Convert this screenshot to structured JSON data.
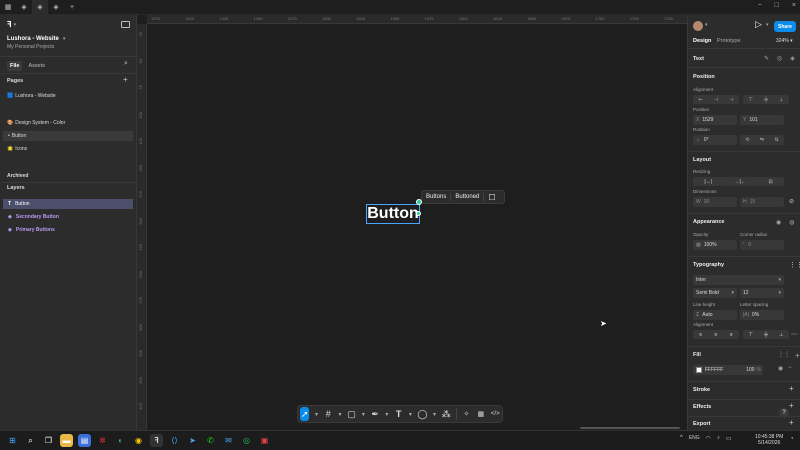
{
  "titlebar": {
    "tabs": [
      "▦",
      "◈",
      "◈",
      "◈",
      "+"
    ],
    "controls": [
      "−",
      "□",
      "×"
    ]
  },
  "left": {
    "project_name": "Lushora - Website",
    "project_sub": "My Personal Projects",
    "tabs": [
      "File",
      "Assets"
    ],
    "pages_label": "Pages",
    "pages_top": [
      "Lushora - Website"
    ],
    "pages": [
      "Design System - Color",
      "Button",
      "Icons"
    ],
    "archived_label": "Archived",
    "layers_label": "Layers",
    "layers": [
      {
        "icon": "T",
        "label": "Button"
      },
      {
        "icon": "◈",
        "label": "Secondary Button"
      },
      {
        "icon": "◈",
        "label": "Primary Buttons"
      }
    ]
  },
  "canvas": {
    "ruler_top": [
      "1375",
      "1400",
      "1425",
      "1450",
      "1475",
      "1500",
      "1525",
      "1550",
      "1575",
      "1600",
      "1625",
      "1650",
      "1675",
      "1700",
      "1725",
      "1750"
    ],
    "ruler_left": [
      "25",
      "50",
      "75",
      "100",
      "125",
      "150",
      "175",
      "200",
      "225",
      "250",
      "275",
      "300",
      "325",
      "350",
      "375"
    ],
    "selected_text": "Button",
    "suggestions": [
      "Buttons",
      "Buttoned"
    ],
    "tools": [
      "pointer",
      "frame",
      "rectangle",
      "pen",
      "text",
      "comment",
      "actions",
      "dev-mode",
      "code"
    ]
  },
  "right": {
    "zoom": "324%",
    "tabs": [
      "Design",
      "Prototype"
    ],
    "share": "Share",
    "text_label": "Text",
    "position_label": "Position",
    "alignment_label": "Alignment",
    "position_sub": "Position",
    "x_label": "X",
    "x_value": "1529",
    "y_label": "Y",
    "y_value": "101",
    "rotation_label": "Rotation",
    "rotation_value": "0°",
    "layout_label": "Layout",
    "resizing_label": "Resizing",
    "dimensions_label": "Dimensions",
    "w_label": "W",
    "w_value": "30",
    "h_label": "H",
    "h_value": "15",
    "appearance_label": "Appearance",
    "opacity_label": "Opacity",
    "opacity_value": "100%",
    "radius_label": "Corner radius",
    "radius_value": "0",
    "typography_label": "Typography",
    "font_family": "Inter",
    "font_weight": "Semi Bold",
    "font_size": "12",
    "line_height_label": "Line height",
    "line_height_value": "Auto",
    "letter_spacing_label": "Letter spacing",
    "letter_spacing_value": "0%",
    "text_align_label": "Alignment",
    "fill_label": "Fill",
    "fill_hex": "FFFFFF",
    "fill_opacity": "100",
    "fill_pct": "%",
    "stroke_label": "Stroke",
    "effects_label": "Effects",
    "export_label": "Export",
    "help": "?"
  },
  "taskbar": {
    "time": "10:45:38 PM",
    "date": "5/14/2026",
    "lang": "ENG"
  },
  "colors": {
    "accent": "#0c8ce9",
    "selection": "#4aa3ff",
    "panel": "#2c2c2c",
    "canvas": "#1e1e1e",
    "layer_purple": "#b99af5"
  }
}
